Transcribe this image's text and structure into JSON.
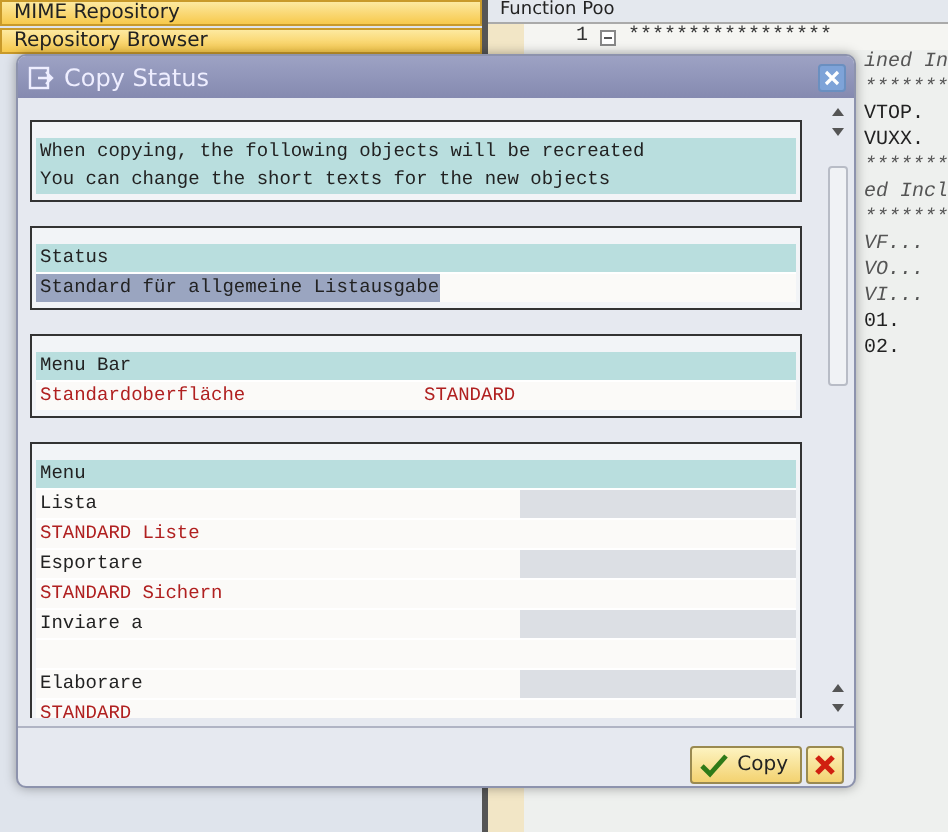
{
  "background": {
    "left_items": [
      {
        "label": "MIME Repository"
      },
      {
        "label": "Repository Browser"
      }
    ],
    "header": {
      "label": "Function Poo"
    },
    "editor": {
      "line_number": "1",
      "lines": [
        {
          "text": "*****************"
        },
        {
          "text": "ined In"
        },
        {
          "text": "*******"
        },
        {
          "text": "VTOP."
        },
        {
          "text": "VUXX."
        },
        {
          "text": "*******"
        },
        {
          "text": "ed Incl"
        },
        {
          "text": "*******"
        },
        {
          "text": "VF..."
        },
        {
          "text": "VO..."
        },
        {
          "text": "VI..."
        },
        {
          "text": "01."
        },
        {
          "text": "02."
        }
      ]
    }
  },
  "dialog": {
    "title": "Copy Status",
    "intro": [
      "When copying, the following objects will be recreated",
      "You can change the short texts for the new objects"
    ],
    "sections": [
      {
        "heading": "Status",
        "rows": [
          {
            "kind": "text",
            "cells": [
              "Standard für allgemeine Listausgabe"
            ],
            "selected": true
          }
        ]
      },
      {
        "heading": "Menu Bar",
        "rows": [
          {
            "kind": "code",
            "cells": [
              "Standardoberfläche",
              "STANDARD"
            ],
            "selected": false
          }
        ]
      },
      {
        "heading": "Menu",
        "rows": [
          {
            "kind": "entry",
            "cells": [
              "Lista"
            ],
            "selected": false
          },
          {
            "kind": "code",
            "cells": [
              "STANDARD Liste"
            ],
            "selected": false
          },
          {
            "kind": "entry",
            "cells": [
              "Esportare"
            ],
            "selected": false
          },
          {
            "kind": "code",
            "cells": [
              "STANDARD Sichern"
            ],
            "selected": false
          },
          {
            "kind": "entry",
            "cells": [
              "Inviare a"
            ],
            "selected": false
          },
          {
            "kind": "blank",
            "selected": false
          },
          {
            "kind": "entry",
            "cells": [
              "Elaborare"
            ],
            "selected": false
          },
          {
            "kind": "code",
            "cells": [
              "STANDARD"
            ],
            "selected": false
          }
        ]
      }
    ],
    "buttons": [
      {
        "kind": "confirm",
        "label": "Copy"
      },
      {
        "kind": "cancel"
      }
    ]
  }
}
